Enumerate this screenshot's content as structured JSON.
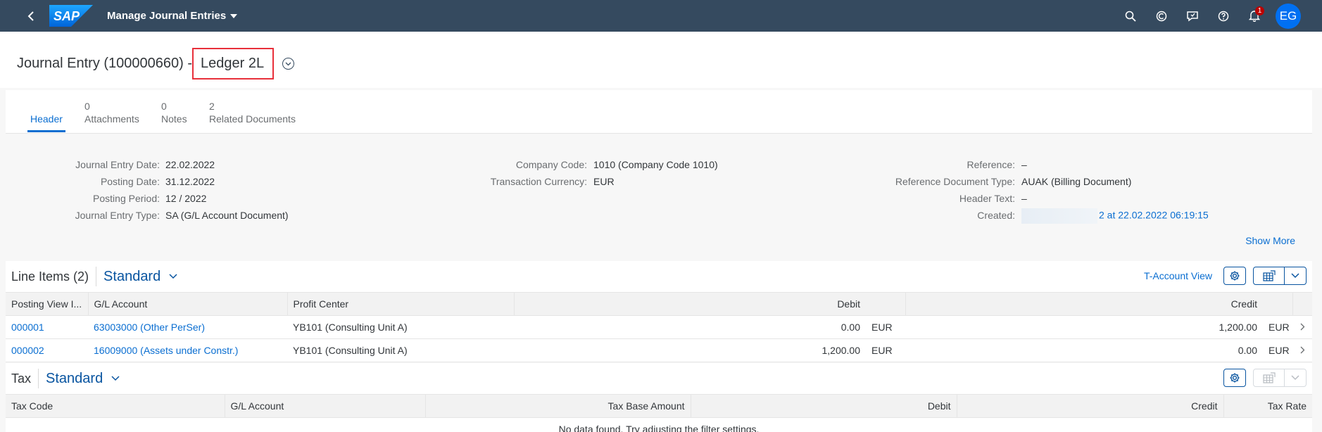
{
  "shell": {
    "app_title": "Manage Journal Entries",
    "logo_text": "SAP",
    "notification_count": "1",
    "user_initials": "EG"
  },
  "object": {
    "title_prefix": "Journal Entry (100000660) -",
    "title_ledger": "Ledger 2L"
  },
  "tabs": [
    {
      "count": "",
      "label": "Header"
    },
    {
      "count": "0",
      "label": "Attachments"
    },
    {
      "count": "0",
      "label": "Notes"
    },
    {
      "count": "2",
      "label": "Related Documents"
    }
  ],
  "header_fields": {
    "col1": [
      {
        "label": "Journal Entry Date:",
        "value": "22.02.2022"
      },
      {
        "label": "Posting Date:",
        "value": "31.12.2022"
      },
      {
        "label": "Posting Period:",
        "value": "12 / 2022"
      },
      {
        "label": "Journal Entry Type:",
        "value": "SA (G/L Account Document)"
      }
    ],
    "col2": [
      {
        "label": "Company Code:",
        "value": "1010 (Company Code 1010)"
      },
      {
        "label": "Transaction Currency:",
        "value": "EUR"
      }
    ],
    "col3": [
      {
        "label": "Reference:",
        "value": "–"
      },
      {
        "label": "Reference Document Type:",
        "value": "AUAK (Billing Document)"
      },
      {
        "label": "Header Text:",
        "value": "–"
      },
      {
        "label": "Created:",
        "value": "2 at 22.02.2022 06:19:15"
      }
    ],
    "show_more": "Show More"
  },
  "line_items": {
    "title": "Line Items (2)",
    "variant": "Standard",
    "t_account_view": "T-Account View",
    "columns": [
      "Posting View I...",
      "G/L Account",
      "Profit Center",
      "Debit",
      "",
      "Credit",
      ""
    ],
    "rows": [
      {
        "item": "000001",
        "gl": "63003000 (Other PerSer)",
        "pc": "YB101 (Consulting Unit A)",
        "debit": "0.00",
        "debit_cur": "EUR",
        "credit": "1,200.00",
        "credit_cur": "EUR"
      },
      {
        "item": "000002",
        "gl": "16009000 (Assets under Constr.)",
        "pc": "YB101 (Consulting Unit A)",
        "debit": "1,200.00",
        "debit_cur": "EUR",
        "credit": "0.00",
        "credit_cur": "EUR"
      }
    ]
  },
  "tax": {
    "title": "Tax",
    "variant": "Standard",
    "columns": [
      "Tax Code",
      "G/L Account",
      "Tax Base Amount",
      "Debit",
      "Credit",
      "Tax Rate"
    ],
    "empty_message": "No data found. Try adjusting the filter settings."
  },
  "colors": {
    "shell": "#354a5f",
    "accent": "#0a6ed1",
    "highlight_box": "#e8303b"
  }
}
